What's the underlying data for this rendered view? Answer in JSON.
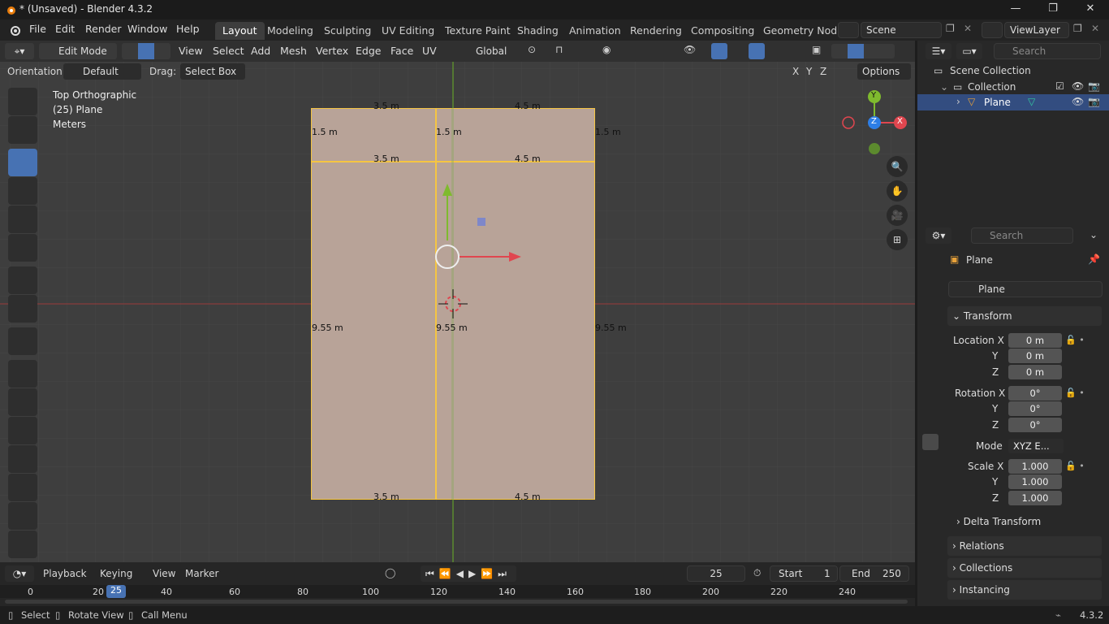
{
  "app": {
    "title": "* (Unsaved) - Blender 4.3.2",
    "minimize": "—",
    "maximize": "❐",
    "close": "✕"
  },
  "menu": {
    "items": [
      "File",
      "Edit",
      "Render",
      "Window",
      "Help"
    ]
  },
  "workspaces": {
    "tabs": [
      "Layout",
      "Modeling",
      "Sculpting",
      "UV Editing",
      "Texture Paint",
      "Shading",
      "Animation",
      "Rendering",
      "Compositing",
      "Geometry Node"
    ],
    "active": "Layout"
  },
  "scene": {
    "name": "Scene",
    "view_layer": "ViewLayer"
  },
  "viewport_header": {
    "mode": "Edit Mode",
    "menus": [
      "View",
      "Select",
      "Add",
      "Mesh",
      "Vertex",
      "Edge",
      "Face",
      "UV"
    ],
    "transform_orientation": "Global"
  },
  "tool_settings": {
    "orientation_label": "Orientation:",
    "orientation_value": "Default",
    "drag_label": "Drag:",
    "drag_value": "Select Box",
    "axes": [
      "X",
      "Y",
      "Z"
    ],
    "options": "Options"
  },
  "viewport": {
    "view_name": "Top Orthographic",
    "object_info": "(25) Plane",
    "units": "Meters",
    "measurements": {
      "top_left": "3.5 m",
      "top_right": "4.5 m",
      "left_top": "1.5 m",
      "mid_top": "1.5 m",
      "right_top": "1.5 m",
      "mid_left": "3.5 m",
      "mid_right": "4.5 m",
      "left_long": "9.55 m",
      "center_long": "9.55 m",
      "right_long": "9.55 m",
      "bottom_left": "3.5 m",
      "bottom_right": "4.5 m"
    },
    "gizmo": {
      "y": "Y",
      "z": "Z",
      "x": "X"
    }
  },
  "outliner": {
    "search_placeholder": "Search",
    "scene_collection": "Scene Collection",
    "collection": "Collection",
    "object": "Plane"
  },
  "properties": {
    "search_placeholder": "Search",
    "object_name": "Plane",
    "data_name": "Plane",
    "transform_title": "Transform",
    "location": {
      "label": "Location X",
      "x": "0 m",
      "y": "0 m",
      "z": "0 m"
    },
    "rotation": {
      "label": "Rotation X",
      "x": "0°",
      "y": "0°",
      "z": "0°"
    },
    "mode": {
      "label": "Mode",
      "value": "XYZ E..."
    },
    "scale": {
      "label": "Scale X",
      "x": "1.000",
      "y": "1.000",
      "z": "1.000"
    },
    "y_label": "Y",
    "z_label": "Z",
    "delta": "Delta Transform",
    "relations": "Relations",
    "collections": "Collections",
    "instancing": "Instancing"
  },
  "timeline": {
    "menus": [
      "Playback",
      "Keying",
      "View",
      "Marker"
    ],
    "current_frame": "25",
    "start_label": "Start",
    "start": "1",
    "end_label": "End",
    "end": "250",
    "ticks": [
      "0",
      "20",
      "40",
      "60",
      "80",
      "100",
      "120",
      "140",
      "160",
      "180",
      "200",
      "220",
      "240"
    ],
    "playhead": "25"
  },
  "status": {
    "select": "Select",
    "rotate": "Rotate View",
    "call_menu": "Call Menu",
    "version": "4.3.2"
  },
  "colors": {
    "accent": "#4772b3",
    "face": "#b8a398",
    "edge": "#f5c542",
    "x_axis": "#e0464f",
    "y_axis": "#7fba2e",
    "z_axis": "#2d7ee6"
  }
}
